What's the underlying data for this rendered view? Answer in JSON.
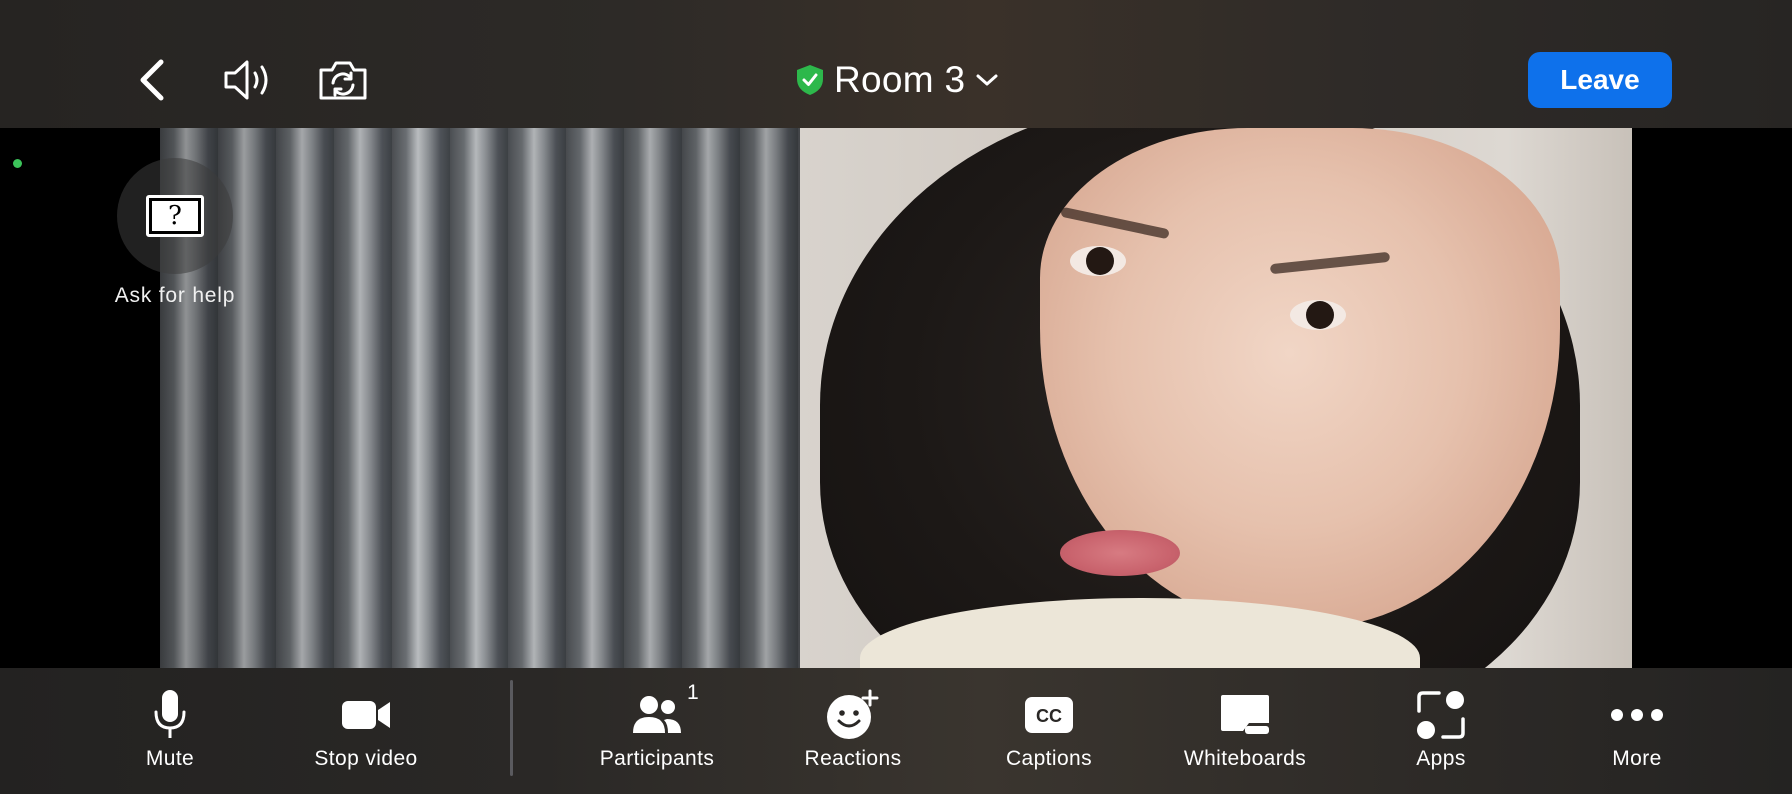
{
  "header": {
    "room_title": "Room 3",
    "leave_label": "Leave",
    "icons": [
      "back-icon",
      "speaker-icon",
      "switch-camera-icon",
      "shield-check-icon",
      "chevron-down-icon"
    ]
  },
  "help": {
    "label": "Ask for help",
    "icon": "question-box-icon"
  },
  "toolbar": {
    "items": [
      {
        "label": "Mute",
        "icon": "microphone-icon"
      },
      {
        "label": "Stop video",
        "icon": "video-camera-icon"
      },
      {
        "label": "Participants",
        "icon": "participants-icon",
        "badge": "1"
      },
      {
        "label": "Reactions",
        "icon": "reaction-icon"
      },
      {
        "label": "Captions",
        "icon": "cc-icon",
        "icon_text": "CC"
      },
      {
        "label": "Whiteboards",
        "icon": "whiteboard-icon"
      },
      {
        "label": "Apps",
        "icon": "apps-icon"
      },
      {
        "label": "More",
        "icon": "more-icon"
      }
    ]
  },
  "colors": {
    "accent": "#0e71eb",
    "shield": "#2db84b",
    "status_dot": "#3cc35a"
  }
}
